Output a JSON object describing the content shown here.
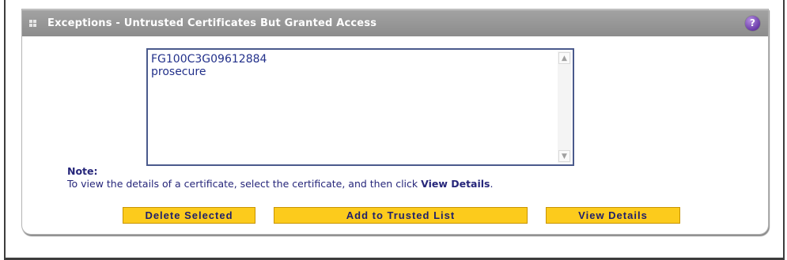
{
  "panel": {
    "title": "Exceptions - Untrusted Certificates But Granted Access",
    "help_glyph": "?"
  },
  "certificate_list": {
    "items": [
      "FG100C3G09612884",
      "prosecure"
    ]
  },
  "note": {
    "label": "Note:",
    "text_before": "To view the details of a certificate, select the certificate, and then click ",
    "text_bold": "View Details",
    "text_after": "."
  },
  "buttons": {
    "delete_selected": "Delete Selected",
    "add_to_trusted_list": "Add to Trusted List",
    "view_details": "View Details"
  },
  "colors": {
    "header_bar": "#999999",
    "button_fill": "#fccb1c",
    "text_blue": "#26267a",
    "help_icon": "#6a3aa8"
  },
  "icons": {
    "expand": "expand-grid-icon",
    "help": "help-icon",
    "scroll_up": "scroll-up-icon",
    "scroll_down": "scroll-down-icon"
  }
}
